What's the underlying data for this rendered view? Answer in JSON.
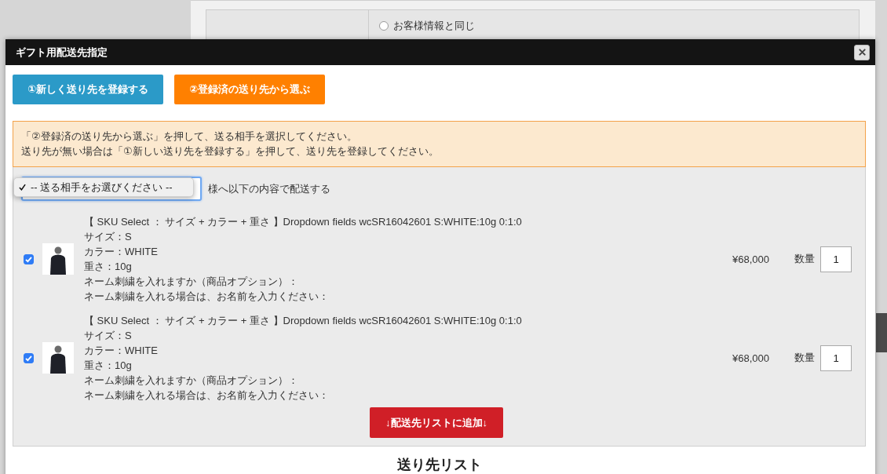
{
  "background_form": {
    "options": [
      {
        "label": "お客様情報と同じ",
        "selected": false
      }
    ]
  },
  "dialog": {
    "title": "ギフト用配送先指定"
  },
  "actions": [
    {
      "label": "①新しく送り先を登録する",
      "color": "#2b9ac8"
    },
    {
      "label": "②登録済の送り先から選ぶ",
      "color": "#ff8000"
    }
  ],
  "notice": {
    "lines": [
      "「②登録済の送り先から選ぶ」を押して、送る相手を選択してください。",
      "送り先が無い場合は「①新しい送り先を登録する」を押して、送り先を登録してください。"
    ]
  },
  "recipient": {
    "options": [
      {
        "label": "-- 送る相手をお選びください --",
        "selected": true
      }
    ],
    "suffix": "様へ以下の内容で配送する"
  },
  "products": [
    {
      "checked": true,
      "lines": [
        "【 SKU Select ： サイズ + カラー + 重さ 】Dropdown fields wcSR16042601 S:WHITE:10g 0:1:0",
        "サイズ：S",
        "カラー：WHITE",
        "重さ：10g",
        "ネーム刺繍を入れますか（商品オプション）：",
        "ネーム刺繍を入れる場合は、お名前を入力ください："
      ],
      "price": "¥68,000",
      "quantity_label": "数量",
      "quantity": "1"
    },
    {
      "checked": true,
      "lines": [
        "【 SKU Select ： サイズ + カラー + 重さ 】Dropdown fields wcSR16042601 S:WHITE:10g 0:1:0",
        "サイズ：S",
        "カラー：WHITE",
        "重さ：10g",
        "ネーム刺繍を入れますか（商品オプション）：",
        "ネーム刺繍を入れる場合は、お名前を入力ください："
      ],
      "price": "¥68,000",
      "quantity_label": "数量",
      "quantity": "1"
    }
  ],
  "add_button": {
    "label": "↓配送先リストに追加↓"
  },
  "list_heading": "送り先リスト"
}
